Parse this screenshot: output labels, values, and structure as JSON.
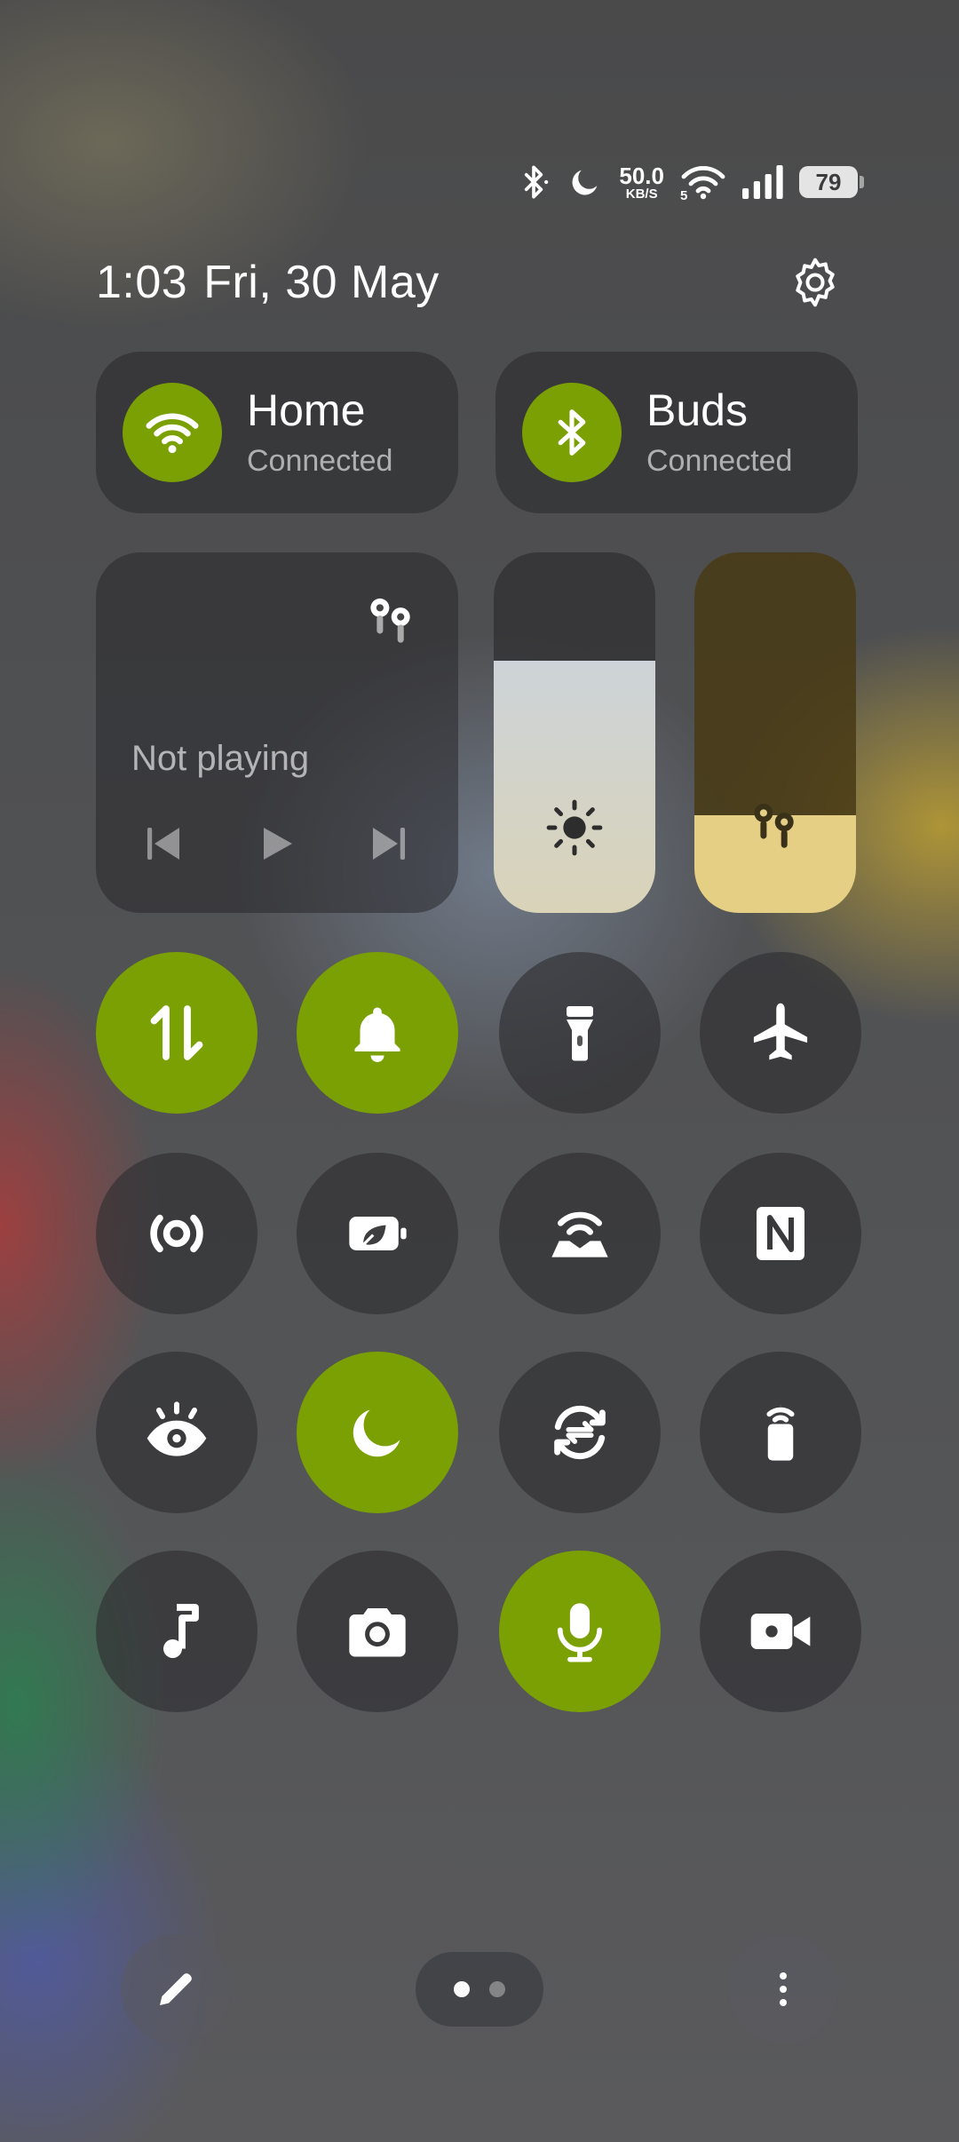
{
  "status_bar": {
    "icons": [
      "bluetooth-icon",
      "moon-icon",
      "wifi-icon",
      "signal-icon"
    ],
    "network_speed": "50.0",
    "network_speed_unit": "KB/S",
    "wifi_band": "5",
    "battery": "79"
  },
  "header": {
    "time": "1:03",
    "date": "Fri, 30 May",
    "settings_icon": "gear-icon"
  },
  "connections": [
    {
      "title": "Home",
      "subtitle": "Connected",
      "icon": "wifi-icon"
    },
    {
      "title": "Buds",
      "subtitle": "Connected",
      "icon": "bluetooth-icon"
    }
  ],
  "media": {
    "status": "Not playing",
    "device_icon": "earbuds-icon",
    "controls": [
      "previous-icon",
      "play-icon",
      "next-icon"
    ]
  },
  "sliders": {
    "brightness": {
      "level": 0.7,
      "icon": "sun-icon"
    },
    "volume": {
      "level": 0.27,
      "icon": "earbuds-icon"
    }
  },
  "toggles": [
    {
      "name": "mobile-data",
      "icon": "data-arrows-icon",
      "on": true
    },
    {
      "name": "sound",
      "icon": "bell-icon",
      "on": true
    },
    {
      "name": "flashlight",
      "icon": "flashlight-icon",
      "on": false
    },
    {
      "name": "airplane-mode",
      "icon": "airplane-icon",
      "on": false
    },
    {
      "name": "hotspot",
      "icon": "broadcast-icon",
      "on": false
    },
    {
      "name": "battery-saver",
      "icon": "battery-leaf-icon",
      "on": false
    },
    {
      "name": "wifi-cast",
      "icon": "wifi-device-icon",
      "on": false
    },
    {
      "name": "nfc",
      "icon": "nfc-icon",
      "on": false
    },
    {
      "name": "eye-comfort",
      "icon": "eye-icon",
      "on": false
    },
    {
      "name": "do-not-disturb",
      "icon": "moon-icon",
      "on": true
    },
    {
      "name": "sync",
      "icon": "sync-icon",
      "on": false
    },
    {
      "name": "find-device",
      "icon": "phone-signal-icon",
      "on": false
    },
    {
      "name": "music-recognition",
      "icon": "music-note-icon",
      "on": false
    },
    {
      "name": "camera",
      "icon": "camera-icon",
      "on": false
    },
    {
      "name": "microphone",
      "icon": "microphone-icon",
      "on": true
    },
    {
      "name": "video-camera",
      "icon": "video-camera-icon",
      "on": false
    }
  ],
  "bottom": {
    "edit_icon": "pencil-icon",
    "more_icon": "more-vertical-icon",
    "pages": 2,
    "current_page": 1
  }
}
